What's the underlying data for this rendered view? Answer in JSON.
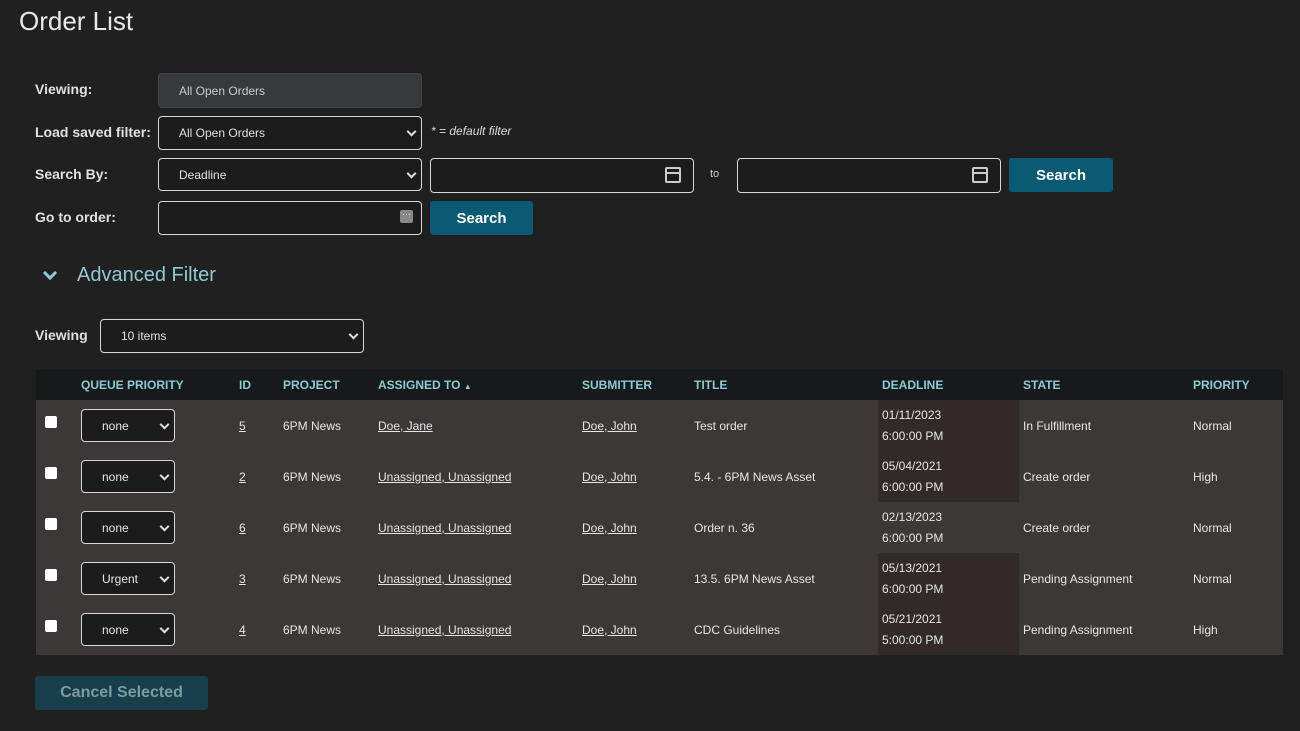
{
  "page_title": "Order List",
  "filters": {
    "viewing_label": "Viewing:",
    "viewing_value": "All Open Orders",
    "saved_filter_label": "Load saved filter:",
    "saved_filter_value": "All Open Orders",
    "default_note": "* = default filter",
    "search_by_label": "Search By:",
    "search_by_value": "Deadline",
    "date_from": "",
    "to_label": "to",
    "date_to": "",
    "search_label": "Search",
    "go_to_label": "Go to order:",
    "go_to_value": "",
    "go_search_label": "Search"
  },
  "advanced_filter_label": "Advanced Filter",
  "page_size": {
    "label": "Viewing",
    "value": "10 items"
  },
  "table": {
    "columns": [
      "QUEUE PRIORITY",
      "ID",
      "PROJECT",
      "ASSIGNED TO",
      "SUBMITTER",
      "TITLE",
      "DEADLINE",
      "STATE",
      "PRIORITY"
    ],
    "sort_indicator": "▲",
    "rows": [
      {
        "queue": "none",
        "id": "5",
        "project": "6PM News",
        "assigned": "Doe, Jane",
        "submitter": "Doe, John",
        "title": "Test order",
        "date": "01/11/2023",
        "time": "6:00:00 PM",
        "late": true,
        "state": "In Fulfillment",
        "priority": "Normal"
      },
      {
        "queue": "none",
        "id": "2",
        "project": "6PM News",
        "assigned": "Unassigned, Unassigned",
        "submitter": "Doe, John",
        "title": "5.4. - 6PM News Asset",
        "date": "05/04/2021",
        "time": "6:00:00 PM",
        "late": true,
        "state": "Create order",
        "priority": "High"
      },
      {
        "queue": "none",
        "id": "6",
        "project": "6PM News",
        "assigned": "Unassigned, Unassigned",
        "submitter": "Doe, John",
        "title": "Order n. 36",
        "date": "02/13/2023",
        "time": "6:00:00 PM",
        "late": false,
        "state": "Create order",
        "priority": "Normal"
      },
      {
        "queue": "Urgent",
        "id": "3",
        "project": "6PM News",
        "assigned": "Unassigned, Unassigned",
        "submitter": "Doe, John",
        "title": "13.5. 6PM News Asset",
        "date": "05/13/2021",
        "time": "6:00:00 PM",
        "late": true,
        "state": "Pending Assignment",
        "priority": "Normal"
      },
      {
        "queue": "none",
        "id": "4",
        "project": "6PM News",
        "assigned": "Unassigned, Unassigned",
        "submitter": "Doe, John",
        "title": "CDC Guidelines",
        "date": "05/21/2021",
        "time": "5:00:00 PM",
        "late": true,
        "state": "Pending Assignment",
        "priority": "High"
      }
    ]
  },
  "cancel_label": "Cancel Selected",
  "colors": {
    "accent": "#0b5a73",
    "header_text": "#8ec9d6",
    "advanced": "#8ec9d6"
  }
}
